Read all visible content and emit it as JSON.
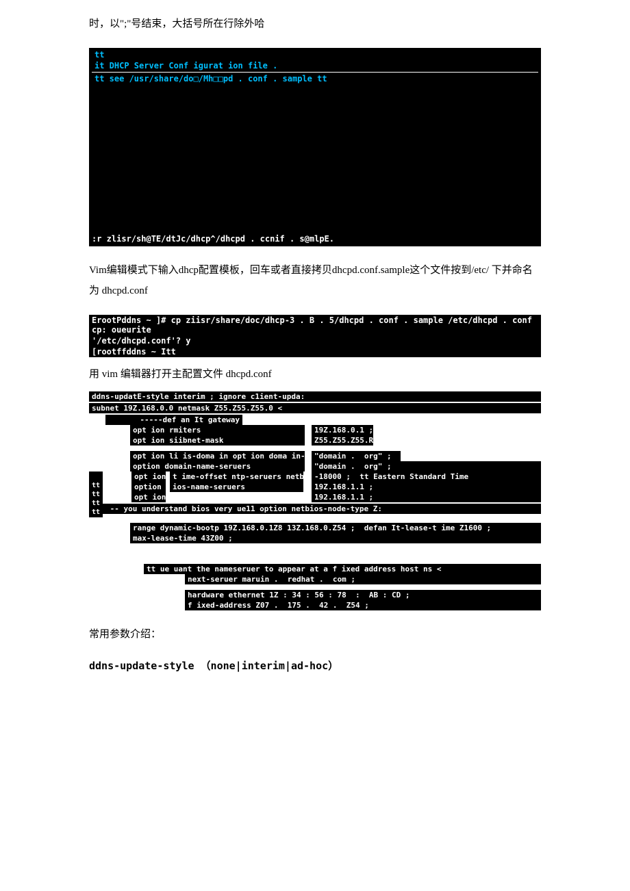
{
  "para1": "时，以\";\"号结束，大括号所在行除外哈",
  "terminal1": {
    "line1": "tt",
    "line2": "it DHCP Server Conf igurat ion file .",
    "line3": "tt see /usr/share/do□/Mh□□pd .  conf .  sample tt",
    "bottom": ":r zlisr/sh@TE/dtJc/dhcp^/dhcpd .  ccnif .  s@mlpE."
  },
  "para2": "Vim编辑模式下输入dhcp配置模板，回车或者直接拷贝dhcpd.conf.sample这个文件按到/etc/ 下并命名为 dhcpd.conf",
  "terminal2": {
    "line1": "  ErootPddns ~ ]# cp ziisr/share/doc/dhcp-3 .  B .  5/dhcpd .  conf .  sample /etc/dhcpd .  conf cp: oueurite",
    "line2": "'/etc/dhcpd.conf'? y",
    "line3": "[rootffddns ~ Itt"
  },
  "para3": "用  vim 编辑器打开主配置文件  dhcpd.conf",
  "config": {
    "l1": "ddns-updatE-style interim ;  ignore c1ient-upda:",
    "l2": "subnet 19Z.168.0.0 netmask Z55.Z55.Z55.0 <",
    "l3": "       -----def an It gateway",
    "l4a": "opt ion rmiters",
    "l4b": "19Z.168.0.1 ;",
    "l5a": "opt ion siibnet-mask",
    "l5b": "Z55.Z55.Z55.R .",
    "l6a": "opt ion li is-doma in opt ion doma in-name",
    "l6b": "\"domain .  org\" ;",
    "l7a": "option domain-name-seruers",
    "l7b": "\"domain .  org\" ;",
    "l8a": "opt ion",
    "l8b": "t ime-offset ntp-seruers netb",
    "l8c": "-18000 ;  tt Eastern Standard Time",
    "l9a": "option",
    "l9b": "ios-name-seruers",
    "l9c": "19Z.168.1.1 ;",
    "l10a": "opt ion",
    "l10c": "192.168.1.1 ;",
    "sideTT": "     tt\ntt\ntt\ntt\ntt",
    "l11": " -- you understand bios very ue11 option netbios-node-type Z:",
    "l12": "range dynamic-bootp 19Z.168.0.1Z8 13Z.168.0.Z54 ;  defan It-lease-t ime Z1600 ;",
    "l13": "max-lease-time 43Z00 ;",
    "l14": "tt ue uant the nameseruer to appear at a f ixed address host ns <",
    "l15": "next-seruer maruin .  redhat .  com ;",
    "l16": "hardware ethernet 1Z : 34 : 56 : 78  :  AB : CD ;",
    "l17": "f ixed-address Z07 .  175 .  42 .  Z54 ;"
  },
  "para4": "常用参数介绍：",
  "heading": "ddns-update-style （none|interim|ad-hoc）"
}
